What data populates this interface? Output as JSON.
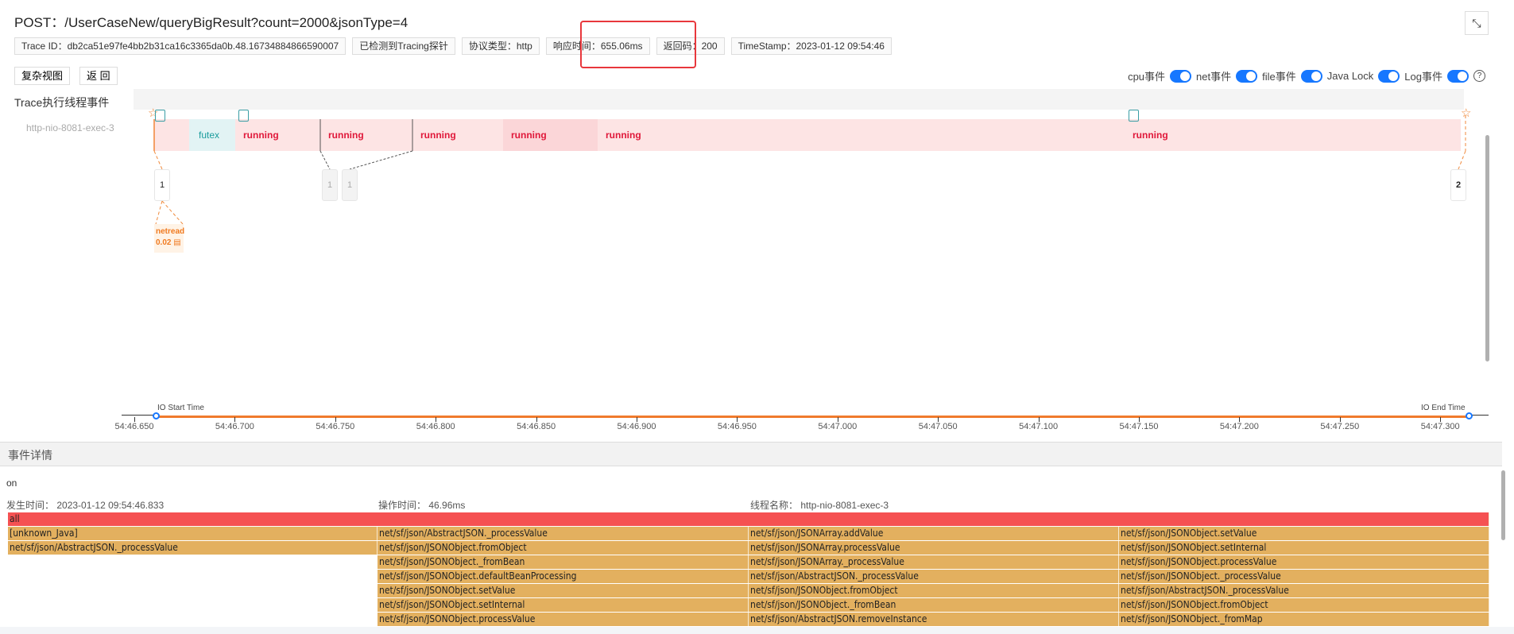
{
  "header": {
    "title": "POST：/UserCaseNew/queryBigResult?count=2000&jsonType=4",
    "badges": [
      "Trace ID：db2ca51e97fe4bb2b31ca16c3365da0b.48.16734884866590007",
      "已检测到Tracing探针",
      "协议类型：http",
      "响应时间：655.06ms",
      "返回码：200",
      "TimeStamp：2023-01-12 09:54:46"
    ],
    "highlighted_badge": "响应时间：655.06ms",
    "highlight_color": "#e8373c"
  },
  "toolbar": {
    "complex_view": "复杂视图",
    "back": "返 回",
    "fullscreen_icon": "fullscreen-exit-icon"
  },
  "toggles": [
    {
      "label": "cpu事件",
      "on": true
    },
    {
      "label": "net事件",
      "on": true
    },
    {
      "label": "file事件",
      "on": true
    },
    {
      "label": "Java Lock",
      "on": true
    },
    {
      "label": "Log事件",
      "on": true
    }
  ],
  "timeline": {
    "section_label": "Trace执行线程事件",
    "thread": "http-nio-8081-exec-3",
    "segments": [
      {
        "label": "",
        "type": "plain"
      },
      {
        "label": "futex",
        "type": "futex"
      },
      {
        "label": "running",
        "type": "running"
      },
      {
        "label": "running",
        "type": "running"
      },
      {
        "label": "running",
        "type": "running"
      },
      {
        "label": "running",
        "type": "dark"
      },
      {
        "label": "running",
        "type": "running"
      },
      {
        "label": "running",
        "type": "running"
      }
    ],
    "markers": [
      "1",
      "1",
      "1",
      "2"
    ],
    "netread": {
      "label": "netread",
      "value": "0.02"
    },
    "io_start": "IO Start Time",
    "io_end": "IO End Time",
    "ticks": [
      "54:46.650",
      "54:46.700",
      "54:46.750",
      "54:46.800",
      "54:46.850",
      "54:46.900",
      "54:46.950",
      "54:47.000",
      "54:47.050",
      "54:47.100",
      "54:47.150",
      "54:47.200",
      "54:47.250",
      "54:47.300"
    ],
    "colors": {
      "running": "#e0183a",
      "futex": "#1a9c9c",
      "lane": "#fde4e4",
      "axis": "#f07a2c"
    }
  },
  "detail": {
    "title": "事件详情",
    "type": "on",
    "time_label": "发生时间：",
    "time": "2023-01-12 09:54:46.833",
    "duration_label": "操作时间：",
    "duration": "46.96ms",
    "thread_label": "线程名称：",
    "thread": "http-nio-8081-exec-3"
  },
  "flame": {
    "root": "all",
    "colors": {
      "root": "#f55152",
      "frame": "#e3b05f"
    },
    "columns": [
      [
        "[unknown_Java]",
        "net/sf/json/AbstractJSON._processValue"
      ],
      [
        "net/sf/json/AbstractJSON._processValue",
        "net/sf/json/JSONObject.fromObject",
        "net/sf/json/JSONObject._fromBean",
        "net/sf/json/JSONObject.defaultBeanProcessing",
        "net/sf/json/JSONObject.setValue",
        "net/sf/json/JSONObject.setInternal",
        "net/sf/json/JSONObject.processValue"
      ],
      [
        "net/sf/json/JSONArray.addValue",
        "net/sf/json/JSONArray.processValue",
        "net/sf/json/JSONArray._processValue",
        "net/sf/json/AbstractJSON._processValue",
        "net/sf/json/JSONObject.fromObject",
        "net/sf/json/JSONObject._fromBean",
        "net/sf/json/AbstractJSON.removeInstance"
      ],
      [
        "net/sf/json/JSONObject.setValue",
        "net/sf/json/JSONObject.setInternal",
        "net/sf/json/JSONObject.processValue",
        "net/sf/json/JSONObject._processValue",
        "net/sf/json/AbstractJSON._processValue",
        "net/sf/json/JSONObject.fromObject",
        "net/sf/json/JSONObject._fromMap"
      ]
    ]
  }
}
